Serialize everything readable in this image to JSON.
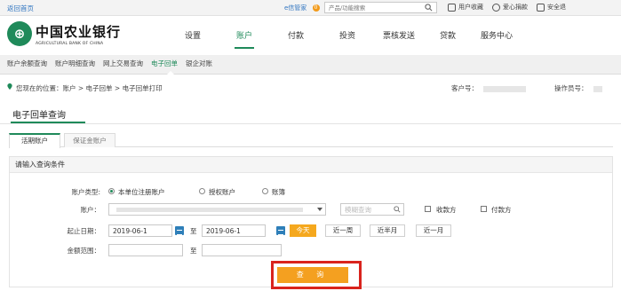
{
  "topbar": {
    "back_link": "返回首页",
    "notice": "e信管家",
    "notice_badge": "0",
    "search_placeholder": "产品/功能搜索",
    "links": [
      "用户收藏",
      "爱心捐款",
      "安全退"
    ]
  },
  "header": {
    "logo_cn": "中国农业银行",
    "logo_en": "AGRICULTURAL BANK OF CHINA",
    "nav": [
      "设置",
      "账户",
      "付款",
      "投资",
      "票核发送",
      "贷款",
      "服务中心"
    ],
    "active_nav": "账户"
  },
  "subnav": {
    "items": [
      "账户余额查询",
      "账户明细查询",
      "网上交易查询",
      "电子回单",
      "银企对账"
    ],
    "active": "电子回单"
  },
  "location": {
    "path": "您现在的位置：账户 > 电子回单 > 电子回单打印",
    "acct_label": "客户号：",
    "operator_label": "操作员号："
  },
  "page": {
    "title": "电子回单查询"
  },
  "tabs": [
    "活期账户",
    "保证金账户"
  ],
  "panel": {
    "heading": "请输入查询条件",
    "account_type_label": "账户类型:",
    "account_type_options": [
      "本单位注册账户",
      "授权账户",
      "账簿"
    ],
    "account_label": "账户：",
    "account_search_placeholder": "模糊查询",
    "checkbox_receive": "收款方",
    "checkbox_pay": "付款方",
    "date_label": "起止日期：",
    "date_from": "2019-06-1",
    "date_to": "2019-06-1",
    "date_sep": "至",
    "quick_dates": [
      "今天",
      "近一周",
      "近半月",
      "近一月"
    ],
    "amount_label": "金额范围：",
    "amount_sep": "至",
    "query_button": "查 询"
  },
  "colors": {
    "brand_green": "#1f8a5a",
    "accent_orange": "#f4a020",
    "highlight_red": "#d9231d"
  }
}
